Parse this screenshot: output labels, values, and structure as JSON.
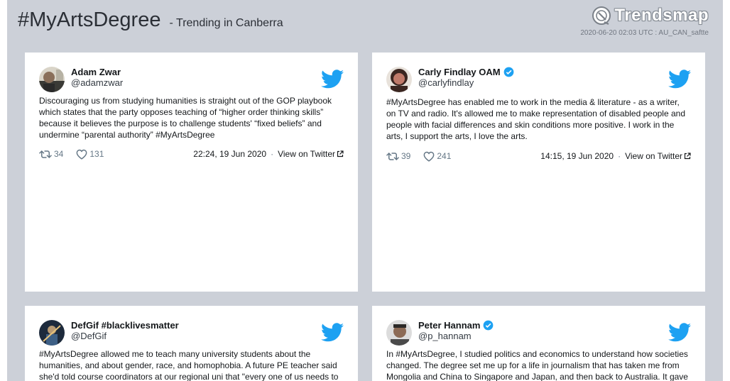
{
  "header": {
    "title": "#MyArtsDegree",
    "subtitle": "- Trending in Canberra",
    "logo_text": "Trendsmap",
    "meta": "2020-06-20 02:03 UTC : AU_CAN_saftte"
  },
  "colors": {
    "background": "#ccd0d8",
    "card": "#ffffff",
    "twitter_blue": "#1da1f2",
    "muted": "#657786"
  },
  "tweets": [
    {
      "name": "Adam Zwar",
      "verified": false,
      "handle": "@adamzwar",
      "text": "Discouraging us from studying humanities is straight out of the GOP playbook which states that the party opposes teaching of “higher order thinking skills” because it believes the purpose is to challenge students' “fixed beliefs” and undermine “parental authority” #MyArtsDegree",
      "retweets": "34",
      "likes": "131",
      "date": "22:24, 19 Jun 2020",
      "view_label": "View on Twitter"
    },
    {
      "name": "Carly Findlay OAM",
      "verified": true,
      "handle": "@carlyfindlay",
      "text": "#MyArtsDegree has enabled me to work in the media & literature - as a writer, on TV and radio. It's allowed me to make representation of disabled people and people with facial differences and skin conditions more positive. I work in the arts, I support the arts, I love the arts.",
      "retweets": "39",
      "likes": "241",
      "date": "14:15, 19 Jun 2020",
      "view_label": "View on Twitter"
    },
    {
      "name": "DefGif #blacklivesmatter",
      "verified": false,
      "handle": "@DefGif",
      "text": "#MyArtsDegree allowed me to teach many university students about the humanities, and about gender, race, and homophobia. A future PE teacher said she'd told course coordinators at our regional uni that \"every one of us needs to"
    },
    {
      "name": "Peter Hannam",
      "verified": true,
      "handle": "@p_hannam",
      "text": "In #MyArtsDegree, I studied politics and economics to understand how societies changed. The degree set me up for a life in journalism that has taken me from Mongolia and China to Singapore and Japan, and then back to Australia. It gave"
    }
  ]
}
